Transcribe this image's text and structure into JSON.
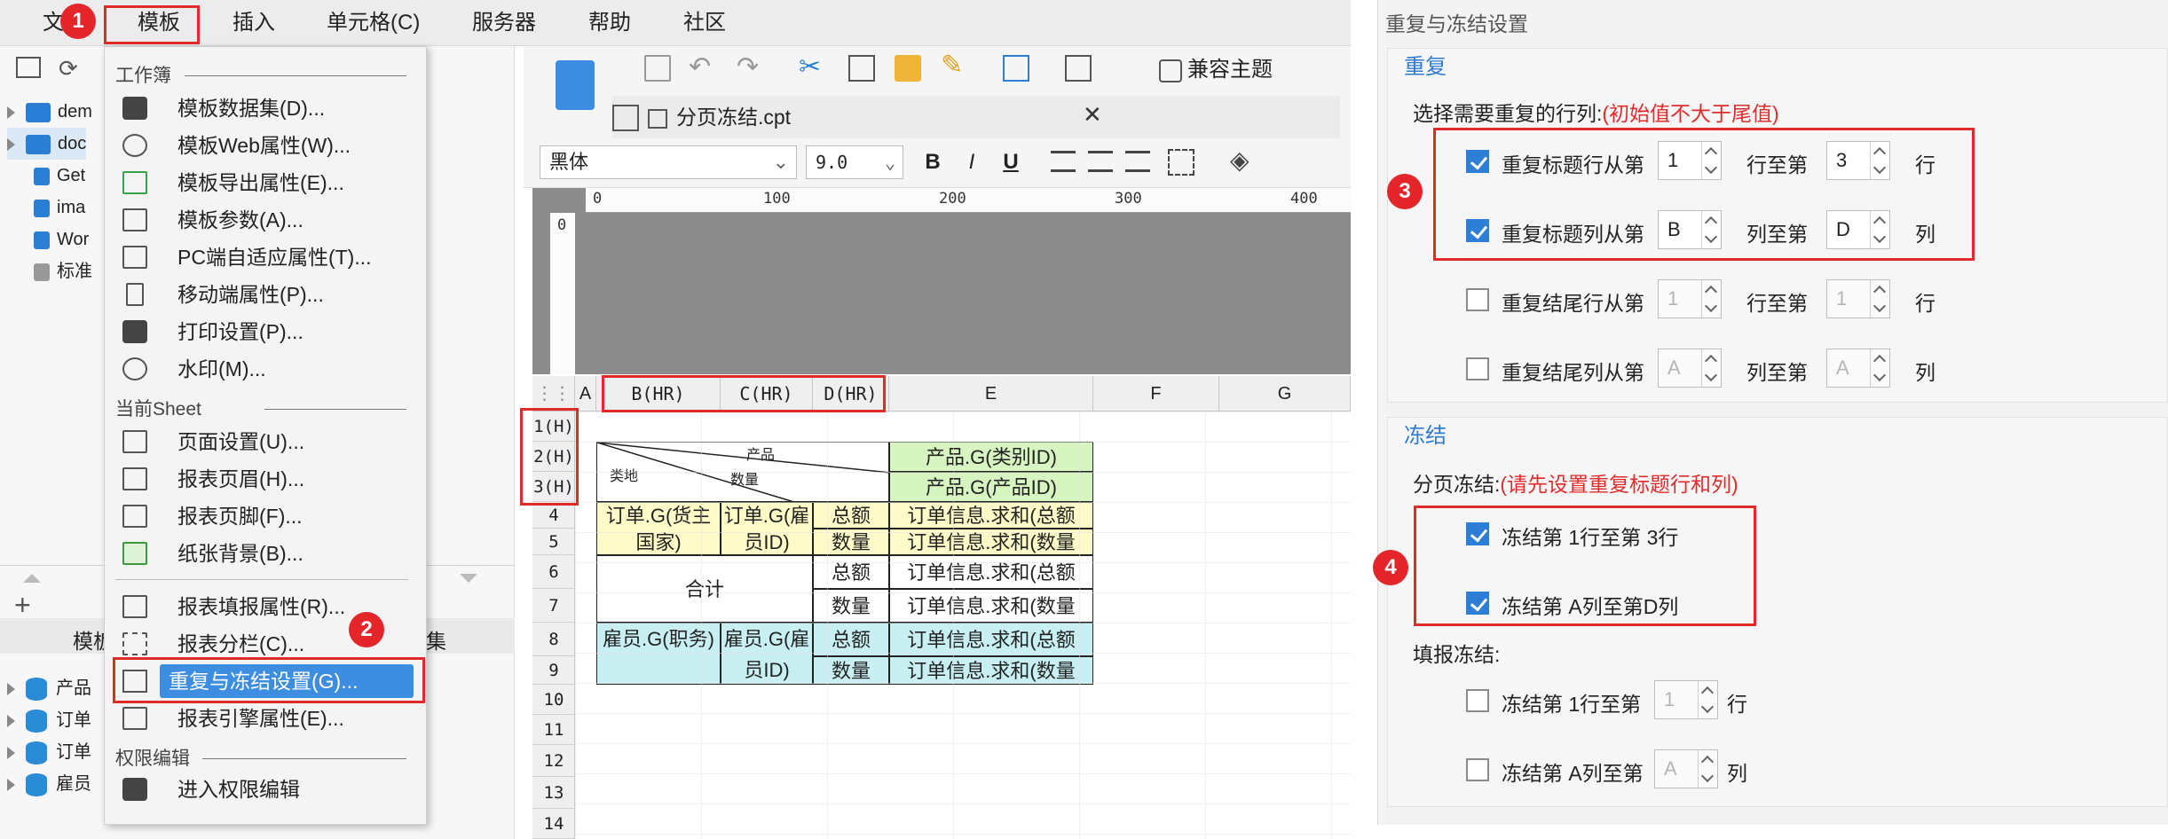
{
  "menubar": {
    "items": [
      "文",
      "模板",
      "插入",
      "单元格(C)",
      "服务器",
      "帮助",
      "社区"
    ]
  },
  "side": {
    "tree_top": [
      "dem",
      "doc",
      "Get",
      "ima",
      "Wor",
      "标准"
    ],
    "bottom_header": [
      "模板",
      "集"
    ],
    "bottom_items": [
      "产品",
      "订单",
      "订单",
      "雇员"
    ]
  },
  "dropdown": {
    "section_workbook": "工作簿",
    "section_sheet": "当前Sheet",
    "section_perm": "权限编辑",
    "workbook_items": [
      "模板数据集(D)...",
      "模板Web属性(W)...",
      "模板导出属性(E)...",
      "模板参数(A)...",
      "PC端自适应属性(T)...",
      "移动端属性(P)...",
      "打印设置(P)...",
      "水印(M)..."
    ],
    "sheet_items": [
      "页面设置(U)...",
      "报表页眉(H)...",
      "报表页脚(F)...",
      "纸张背景(B)...",
      "报表填报属性(R)...",
      "报表分栏(C)...",
      "重复与冻结设置(G)...",
      "报表引擎属性(E)..."
    ],
    "perm_items": [
      "进入权限编辑"
    ]
  },
  "badges": [
    "1",
    "2",
    "3",
    "4"
  ],
  "toolbar": {
    "theme_button": "兼容主题",
    "tab_name": "分页冻结.cpt",
    "font": "黑体",
    "size": "9.0",
    "bold": "B",
    "italic": "I",
    "underline": "U"
  },
  "ruler": {
    "marks": [
      "0",
      "100",
      "200",
      "300",
      "400"
    ],
    "vmark": "0"
  },
  "grid": {
    "col_headers": [
      "A",
      "B(HR)",
      "C(HR)",
      "D(HR)",
      "E",
      "F",
      "G"
    ],
    "row_headers": [
      "1(H)",
      "2(H)",
      "3(H)",
      "4",
      "5",
      "6",
      "7",
      "8",
      "9",
      "10",
      "11",
      "12",
      "13",
      "14"
    ],
    "diag_labels": [
      "产品",
      "数量",
      "类地"
    ],
    "cells": {
      "e23a": "产品.G(类别ID)",
      "e23b": "产品.G(产品ID)",
      "b45": "订单.G(货主国家)",
      "c45": "订单.G(雇员ID)",
      "d4": "总额",
      "d5": "数量",
      "e4": "订单信息.求和(总额",
      "e5": "订单信息.求和(数量",
      "total": "合计",
      "d6": "总额",
      "d7": "数量",
      "e6": "订单信息.求和(总额",
      "e7": "订单信息.求和(数量",
      "b89": "雇员.G(职务)",
      "c89": "雇员.G(雇员ID)",
      "d8": "总额",
      "d9": "数量",
      "e8": "订单信息.求和(总额",
      "e9": "订单信息.求和(数量"
    }
  },
  "dialog": {
    "title": "重复与冻结设置",
    "repeat_group": "重复",
    "repeat_prompt": "选择需要重复的行列:",
    "repeat_hint": "(初始值不大于尾值)",
    "rows": [
      {
        "label": "重复标题行从第",
        "from": "1",
        "mid": "行至第",
        "to": "3",
        "unit": "行",
        "checked": true
      },
      {
        "label": "重复标题列从第",
        "from": "B",
        "mid": "列至第",
        "to": "D",
        "unit": "列",
        "checked": true
      },
      {
        "label": "重复结尾行从第",
        "from": "1",
        "mid": "行至第",
        "to": "1",
        "unit": "行",
        "checked": false
      },
      {
        "label": "重复结尾列从第",
        "from": "A",
        "mid": "列至第",
        "to": "A",
        "unit": "列",
        "checked": false
      }
    ],
    "freeze_group": "冻结",
    "page_freeze_label": "分页冻结:",
    "page_freeze_hint": "(请先设置重复标题行和列)",
    "page_freeze_rows": "冻结第 1行至第 3行",
    "page_freeze_cols": "冻结第 A列至第D列",
    "fill_freeze_label": "填报冻结:",
    "fill_freeze_rows_label": "冻结第 1行至第",
    "fill_freeze_rows_value": "1",
    "fill_freeze_rows_unit": "行",
    "fill_freeze_cols_label": "冻结第 A列至第",
    "fill_freeze_cols_value": "A",
    "fill_freeze_cols_unit": "列"
  }
}
